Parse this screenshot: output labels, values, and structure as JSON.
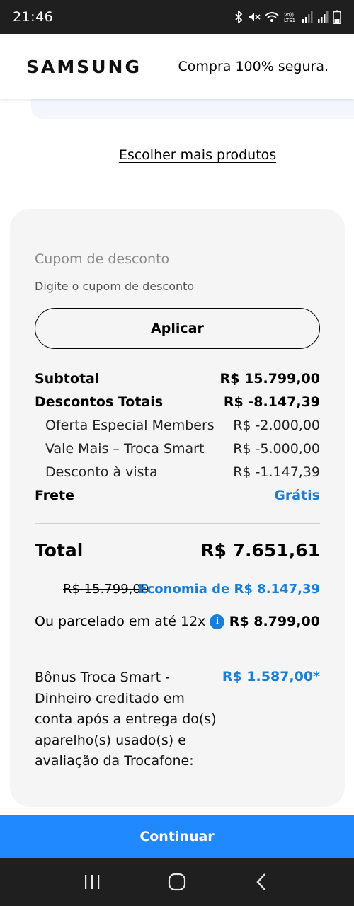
{
  "status_bar": {
    "time": "21:46",
    "icons": [
      "bluetooth-icon",
      "mute-icon",
      "wifi-icon",
      "volte-icon",
      "signal-icon",
      "signal-icon-2",
      "battery-icon"
    ],
    "volte_label": "Vo))\nLTE1"
  },
  "header": {
    "logo": "SAMSUNG",
    "secure_text": "Compra 100% segura."
  },
  "more_products": "Escolher mais produtos",
  "coupon": {
    "placeholder": "Cupom de desconto",
    "value": "",
    "hint": "Digite o cupom de desconto",
    "apply_label": "Aplicar"
  },
  "summary": {
    "subtotal": {
      "label": "Subtotal",
      "value": "R$ 15.799,00"
    },
    "total_discounts": {
      "label": "Descontos Totais",
      "value": "R$ -8.147,39"
    },
    "discounts": [
      {
        "label": "Oferta Especial Members",
        "value": "R$ -2.000,00"
      },
      {
        "label": "Vale Mais – Troca Smart",
        "value": "R$ -5.000,00"
      },
      {
        "label": "Desconto à vista",
        "value": "R$ -1.147,39"
      }
    ],
    "shipping": {
      "label": "Frete",
      "value": "Grátis"
    }
  },
  "total": {
    "label": "Total",
    "value": "R$ 7.651,61",
    "old_price": "R$ 15.799,00",
    "savings": "Economia de R$ 8.147,39"
  },
  "installment": {
    "label": "Ou parcelado em até 12x",
    "info_icon": "i",
    "value": "R$ 8.799,00"
  },
  "bonus": {
    "text": "Bônus Troca Smart - Dinheiro creditado em conta após a entrega do(s) aparelho(s) usado(s) e avaliação da Trocafone:",
    "value": "R$ 1.587,00*"
  },
  "continue_label": "Continuar",
  "colors": {
    "accent": "#1a7fd4",
    "button_blue": "#2189ff",
    "card_bg": "#f5f5f5",
    "system_bar": "#1f1f1f"
  }
}
